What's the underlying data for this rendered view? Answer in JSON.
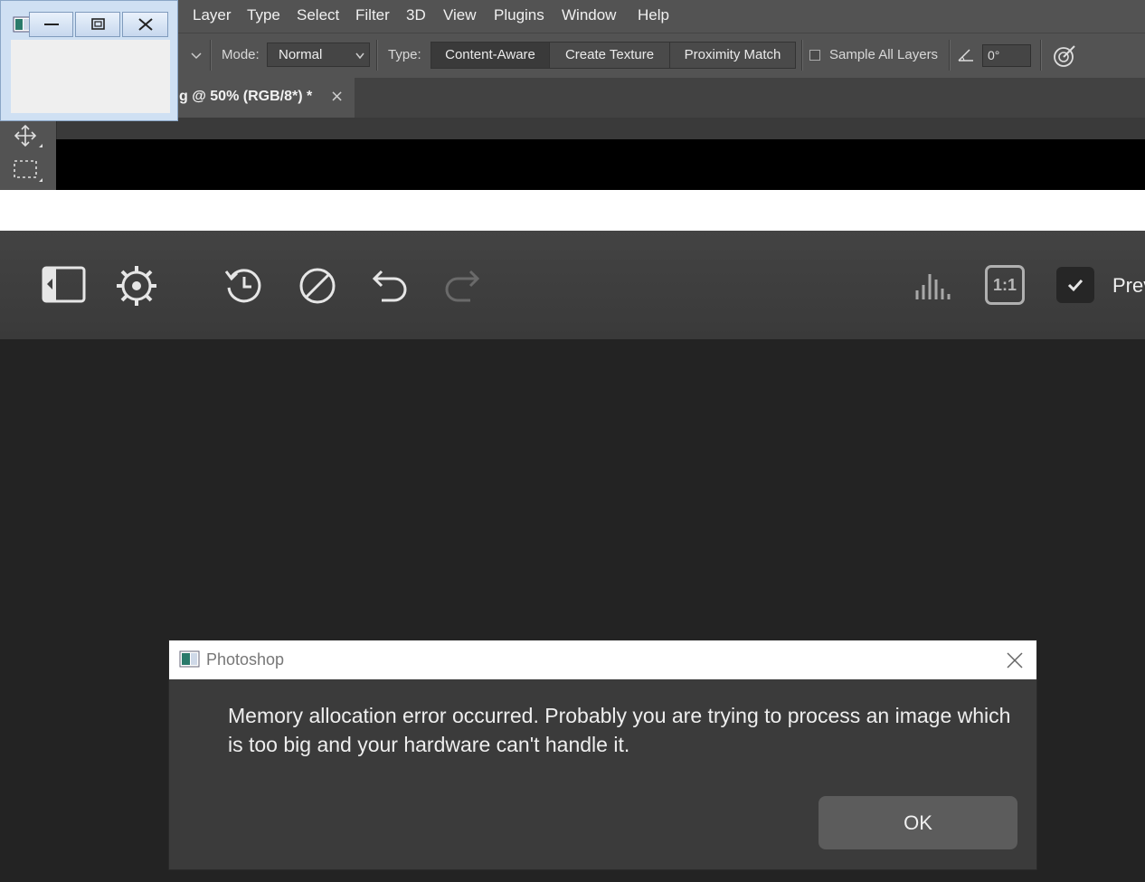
{
  "menu": {
    "items": [
      "Layer",
      "Type",
      "Select",
      "Filter",
      "3D",
      "View",
      "Plugins",
      "Window",
      "Help"
    ]
  },
  "options": {
    "mode_label": "Mode:",
    "mode_value": "Normal",
    "type_label": "Type:",
    "type_buttons": [
      "Content-Aware",
      "Create Texture",
      "Proximity Match"
    ],
    "sample_all_layers": "Sample All Layers",
    "angle_value": "0°"
  },
  "document_tab": {
    "title": "g @ 50% (RGB/8*) *",
    "close_glyph": "×"
  },
  "plugin_toolbar": {
    "zoom_label": "1:1",
    "preview_label": "Prev"
  },
  "dialog": {
    "title": "Photoshop",
    "message": "Memory allocation error occurred. Probably you are trying to process an image which is too big and your hardware can't handle it.",
    "ok_label": "OK"
  }
}
